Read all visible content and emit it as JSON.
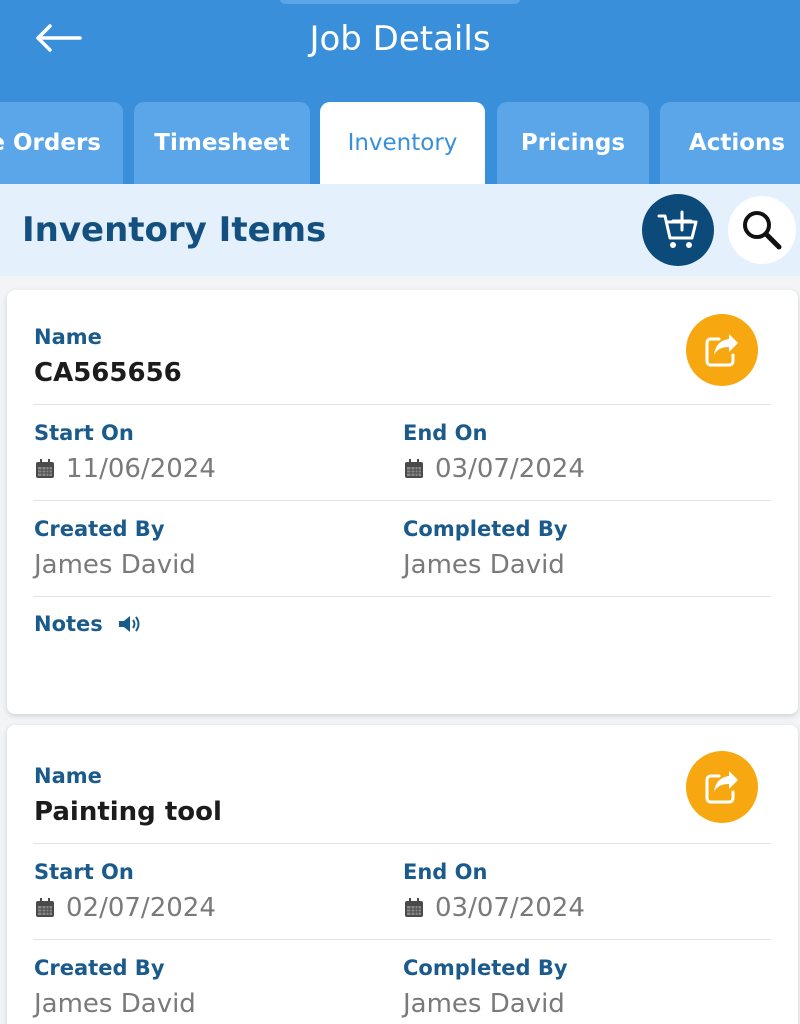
{
  "header": {
    "title": "Job Details",
    "back_icon": "arrow-left-icon",
    "background": "#3a8fda"
  },
  "tabs": [
    {
      "label": "e Orders",
      "active": false
    },
    {
      "label": "Timesheet",
      "active": false
    },
    {
      "label": "Inventory",
      "active": true
    },
    {
      "label": "Pricings",
      "active": false
    },
    {
      "label": "Actions",
      "active": false
    }
  ],
  "section": {
    "title": "Inventory Items",
    "add_cart_icon": "cart-plus-icon",
    "search_icon": "search-icon"
  },
  "labels": {
    "name": "Name",
    "start_on": "Start On",
    "end_on": "End On",
    "created_by": "Created By",
    "completed_by": "Completed By",
    "notes": "Notes"
  },
  "items": [
    {
      "name": "CA565656",
      "start_on": "11/06/2024",
      "end_on": "03/07/2024",
      "created_by": "James David",
      "completed_by": "James David"
    },
    {
      "name": "Painting tool",
      "start_on": "02/07/2024",
      "end_on": "03/07/2024",
      "created_by": "James David",
      "completed_by": "James David"
    }
  ],
  "colors": {
    "accent": "#3a8fda",
    "tab_inactive": "#5ba6e8",
    "label": "#1b5b8c",
    "share_button": "#f7a811",
    "cart_button": "#0b4a79"
  }
}
